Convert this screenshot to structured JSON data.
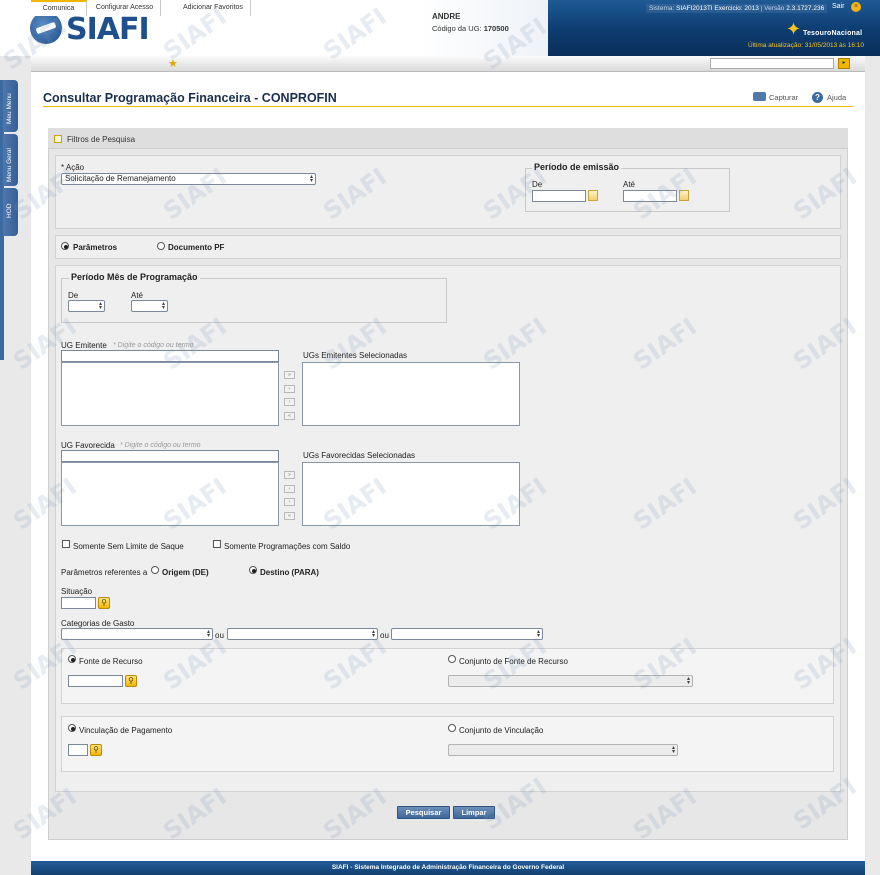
{
  "header": {
    "logo_text": "SIAFI",
    "user_name": "ANDRE",
    "ug_label": "Código da UG:",
    "ug_code": "170500",
    "system_info_label": "Sistema:",
    "system_info_value": "SIAFI2013TI Exercicio: 2013",
    "version_label": "Versão",
    "version_value": "2.3.1727.236",
    "logout_label": "Sair",
    "tesouro_label": "TesouroNacional",
    "last_update": "Última atualização: 31/05/2013 às 16:10"
  },
  "topbar": {
    "tabs": [
      "Comunica",
      "Configurar Acesso",
      "Adicionar Favoritos"
    ],
    "search_value": ""
  },
  "sidebar": {
    "tabs": [
      "Meu Menu",
      "Menu Geral",
      "HOD"
    ]
  },
  "page": {
    "title": "Consultar Programação Financeira - CONPROFIN",
    "capture_label": "Capturar",
    "help_label": "Ajuda"
  },
  "filters": {
    "title": "Filtros de Pesquisa",
    "acao_label": "* Ação",
    "acao_value": "Solicitação de Remanejamento",
    "periodo_emissao_legend": "Período de emissão",
    "de_label": "De",
    "ate_label": "Até",
    "de_value": "",
    "ate_value": "",
    "mode_parametros": "Parâmetros",
    "mode_documento": "Documento PF",
    "periodo_mes_legend": "Período Mês de Programação",
    "mes_de_label": "De",
    "mes_ate_label": "Até",
    "mes_de_value": "",
    "mes_ate_value": "",
    "ug_emitente_label": "UG Emitente",
    "ug_emitente_hint": "* Digite o código ou termo",
    "ug_emitente_value": "",
    "ugs_emitentes_selecionadas": "UGs Emitentes Selecionadas",
    "ug_favorecida_label": "UG Favorecida",
    "ug_favorecida_hint": "* Digite o código ou termo",
    "ug_favorecida_value": "",
    "ugs_favorecidas_selecionadas": "UGs Favorecidas Selecionadas",
    "move_buttons": [
      "»",
      "›",
      "‹",
      "«"
    ],
    "somente_sem_limite": "Somente Sem Limite de Saque",
    "somente_com_saldo": "Somente Programações com Saldo",
    "parametros_ref_label": "Parâmetros referentes a",
    "origem_label": "Origem (DE)",
    "destino_label": "Destino (PARA)",
    "situacao_label": "Situação",
    "situacao_value": "",
    "categorias_label": "Categorias de Gasto",
    "ou_label": "ou",
    "categoria_values": [
      "",
      "",
      ""
    ],
    "fonte_recurso_label": "Fonte de Recurso",
    "fonte_recurso_value": "",
    "conjunto_fonte_label": "Conjunto de Fonte de Recurso",
    "conjunto_fonte_value": "",
    "vinculacao_label": "Vinculação de Pagamento",
    "vinculacao_value": "",
    "conjunto_vinculacao_label": "Conjunto de Vinculação",
    "conjunto_vinculacao_value": "",
    "pesquisar_button": "Pesquisar",
    "limpar_button": "Limpar"
  },
  "footer": {
    "text": "SIAFI - Sistema Integrado de Administração Financeira do Governo Federal"
  },
  "watermark": "SIAFI",
  "colors": {
    "accent": "#f2b705",
    "brand_blue": "#1f4f8c",
    "button_blue": "#3f6698"
  }
}
